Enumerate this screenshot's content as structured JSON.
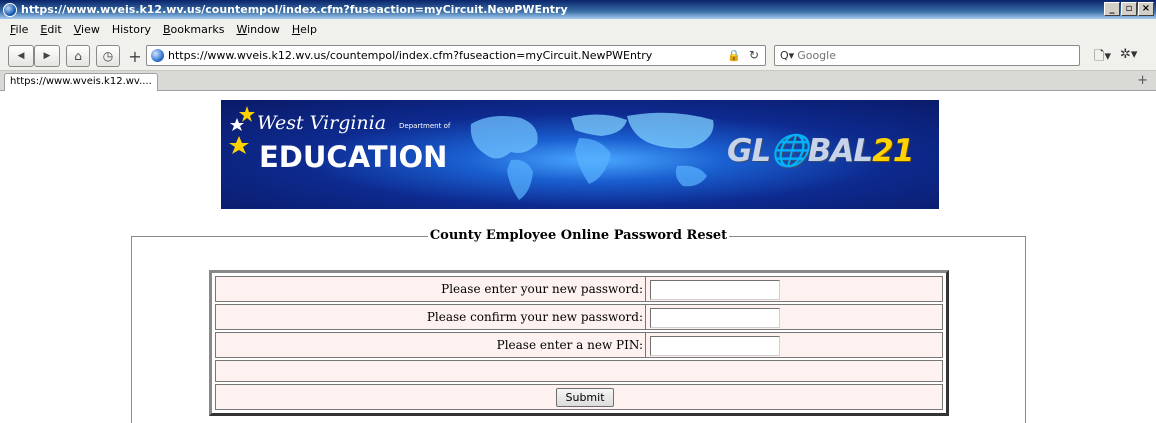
{
  "window": {
    "title": "https://www.wveis.k12.wv.us/countempol/index.cfm?fuseaction=myCircuit.NewPWEntry",
    "controls": [
      "_",
      "▫",
      "×"
    ]
  },
  "menu": {
    "items": [
      {
        "accel": "F",
        "rest": "ile"
      },
      {
        "accel": "E",
        "rest": "dit"
      },
      {
        "accel": "V",
        "rest": "iew"
      },
      {
        "accel": "",
        "rest": "History"
      },
      {
        "accel": "B",
        "rest": "ookmarks"
      },
      {
        "accel": "W",
        "rest": "indow"
      },
      {
        "accel": "H",
        "rest": "elp"
      }
    ]
  },
  "toolbar": {
    "back_glyph": "◀",
    "forward_glyph": "▶",
    "home_glyph": "⌂",
    "history_glyph": "◷",
    "newtab_glyph": "+",
    "url": "https://www.wveis.k12.wv.us/countempol/index.cfm?fuseaction=myCircuit.NewPWEntry",
    "lock_glyph": "🔒",
    "reload_glyph": "↻",
    "search_icon_text": "Q▾",
    "search_placeholder": "Google",
    "page_menu_glyph": "🗋▾",
    "tools_menu_glyph": "✲▾"
  },
  "tabs": {
    "items": [
      {
        "label": "https://www.wveis.k12.wv...."
      }
    ],
    "new_tab_glyph": "+"
  },
  "banner": {
    "state_name": "West Virginia",
    "department": "Department of",
    "education": "EDUCATION",
    "global_prefix": "GL🌐BAL",
    "global_suffix": "21"
  },
  "form": {
    "legend": "County Employee Online Password Reset",
    "fields": [
      {
        "label": "Please enter your new password:",
        "value": ""
      },
      {
        "label": "Please confirm your new password:",
        "value": ""
      },
      {
        "label": "Please enter a new PIN:",
        "value": ""
      }
    ],
    "submit_label": "Submit"
  },
  "colors": {
    "titlebar": "#0a246a",
    "banner_navy": "#0a1a66",
    "row_background": "#fdf2ef",
    "global21_yellow": "#ffd200"
  }
}
